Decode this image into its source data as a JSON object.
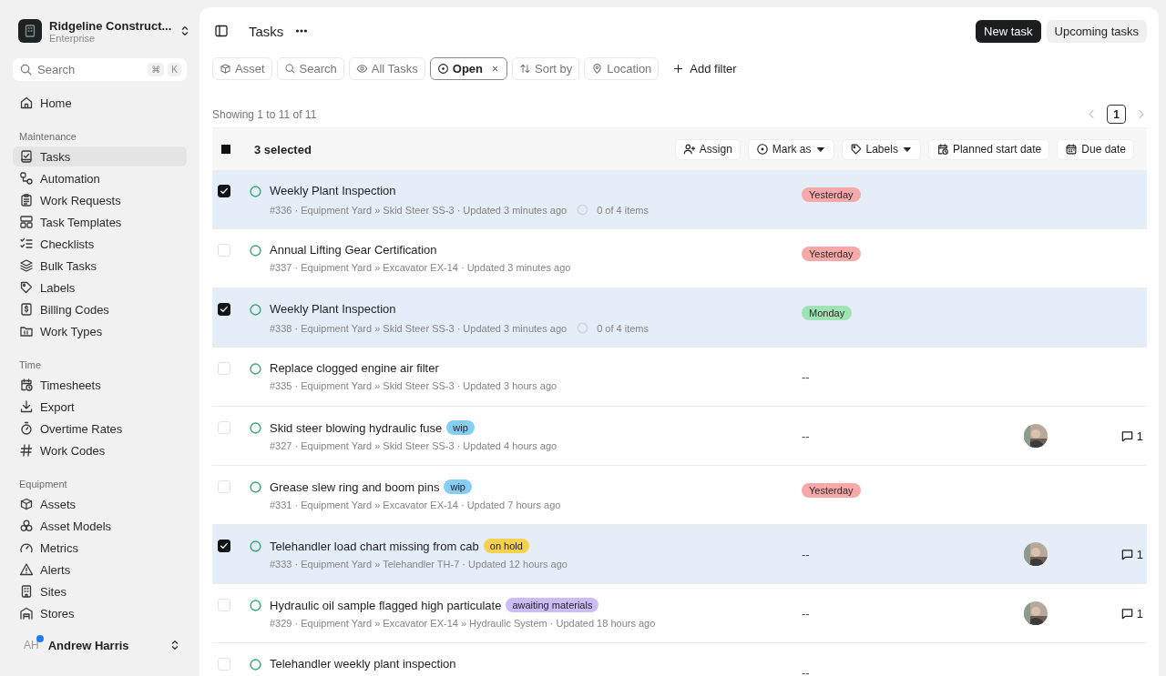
{
  "workspace": {
    "name": "Ridgeline Construct...",
    "plan": "Enterprise"
  },
  "sidebar": {
    "search": {
      "placeholder": "Search",
      "keys": [
        "⌘",
        "K"
      ]
    },
    "sections": [
      {
        "items": [
          {
            "label": "Home",
            "selected": false
          }
        ]
      },
      {
        "heading": "Maintenance",
        "items": [
          {
            "label": "Tasks",
            "selected": true
          },
          {
            "label": "Automation",
            "selected": false
          },
          {
            "label": "Work Requests",
            "selected": false
          },
          {
            "label": "Task Templates",
            "selected": false
          },
          {
            "label": "Checklists",
            "selected": false
          },
          {
            "label": "Bulk Tasks",
            "selected": false
          },
          {
            "label": "Labels",
            "selected": false
          },
          {
            "label": "Billing Codes",
            "selected": false
          },
          {
            "label": "Work Types",
            "selected": false
          }
        ]
      },
      {
        "heading": "Time",
        "items": [
          {
            "label": "Timesheets",
            "selected": false
          },
          {
            "label": "Export",
            "selected": false
          },
          {
            "label": "Overtime Rates",
            "selected": false
          },
          {
            "label": "Work Codes",
            "selected": false
          }
        ]
      },
      {
        "heading": "Equipment",
        "items": [
          {
            "label": "Assets",
            "selected": false
          },
          {
            "label": "Asset Models",
            "selected": false
          },
          {
            "label": "Metrics",
            "selected": false
          },
          {
            "label": "Alerts",
            "selected": false
          },
          {
            "label": "Sites",
            "selected": false
          },
          {
            "label": "Stores",
            "selected": false
          }
        ]
      }
    ],
    "user": {
      "initials": "AH",
      "name": "Andrew Harris",
      "online": true
    }
  },
  "page": {
    "title": "Tasks",
    "buttons": [
      {
        "label": "New task",
        "kind": "primary"
      },
      {
        "label": "Upcoming tasks",
        "kind": "secondary"
      }
    ]
  },
  "filters": [
    {
      "label": "Asset",
      "selected": false
    },
    {
      "label": "Search",
      "selected": false
    },
    {
      "label": "All Tasks",
      "selected": false
    },
    {
      "label": "Open",
      "selected": true
    },
    {
      "label": "Sort by",
      "selected": false
    },
    {
      "label": "Location",
      "selected": false
    }
  ],
  "add_filter": "Add filter",
  "summary": "Showing 1 to 11 of 11",
  "pagination": {
    "pages": [
      {
        "label": "1",
        "selected": true
      }
    ]
  },
  "bulk_bar": {
    "indeterminate": true,
    "count": "3 selected",
    "actions": [
      {
        "label": "Assign",
        "dropdown": false
      },
      {
        "label": "Mark as",
        "dropdown": true
      },
      {
        "label": "Labels",
        "dropdown": true
      },
      {
        "label": "Planned start date",
        "dropdown": false
      },
      {
        "label": "Due date",
        "dropdown": false
      }
    ]
  },
  "rows": [
    {
      "selected": true,
      "title": "Weekly Plant Inspection",
      "meta": "#336 · Equipment Yard » Skid Steer SS-3 · Updated 3 minutes ago",
      "checklist": {
        "label": "0 of 4 items",
        "checked": false
      },
      "due": {
        "label": "Yesterday",
        "color": "#f7a8a8"
      }
    },
    {
      "selected": false,
      "title": "Annual Lifting Gear Certification",
      "meta": "#337 · Equipment Yard » Excavator EX-14 · Updated 3 minutes ago",
      "due": {
        "label": "Yesterday",
        "color": "#f7a8a8"
      }
    },
    {
      "selected": true,
      "title": "Weekly Plant Inspection",
      "meta": "#338 · Equipment Yard » Skid Steer SS-3 · Updated 3 minutes ago",
      "checklist": {
        "label": "0 of 4 items",
        "checked": false
      },
      "due": {
        "label": "Monday",
        "color": "#9fe3b4"
      }
    },
    {
      "selected": false,
      "title": "Replace clogged engine air filter",
      "meta": "#335 · Equipment Yard » Skid Steer SS-3 · Updated 3 hours ago",
      "due": {
        "label": "--"
      }
    },
    {
      "selected": false,
      "title": "Skid steer blowing hydraulic fuse",
      "tag": {
        "label": "wip",
        "color": "#86cdf3"
      },
      "meta": "#327 · Equipment Yard » Skid Steer SS-3 · Updated 4 hours ago",
      "due": {
        "label": "--"
      },
      "comments": "1"
    },
    {
      "selected": false,
      "title": "Grease slew ring and boom pins",
      "tag": {
        "label": "wip",
        "color": "#86cdf3"
      },
      "meta": "#331 · Equipment Yard » Excavator EX-14 · Updated 7 hours ago",
      "due": {
        "label": "Yesterday",
        "color": "#f7a8a8"
      }
    },
    {
      "selected": true,
      "title": "Telehandler load chart missing from cab",
      "tag": {
        "label": "on hold",
        "color": "#f7d04e"
      },
      "meta": "#333 · Equipment Yard » Telehandler TH-7 · Updated 12 hours ago",
      "due": {
        "label": "--"
      },
      "comments": "1"
    },
    {
      "selected": false,
      "title": "Hydraulic oil sample flagged high particulate",
      "tag": {
        "label": "awaiting materials",
        "color": "#cbbcf6"
      },
      "meta": "#329 · Equipment Yard » Excavator EX-14 » Hydraulic System · Updated 18 hours ago",
      "due": {
        "label": "--"
      },
      "comments": "1"
    },
    {
      "selected": false,
      "title": "Telehandler weekly plant inspection",
      "due": {
        "label": "--"
      }
    }
  ]
}
